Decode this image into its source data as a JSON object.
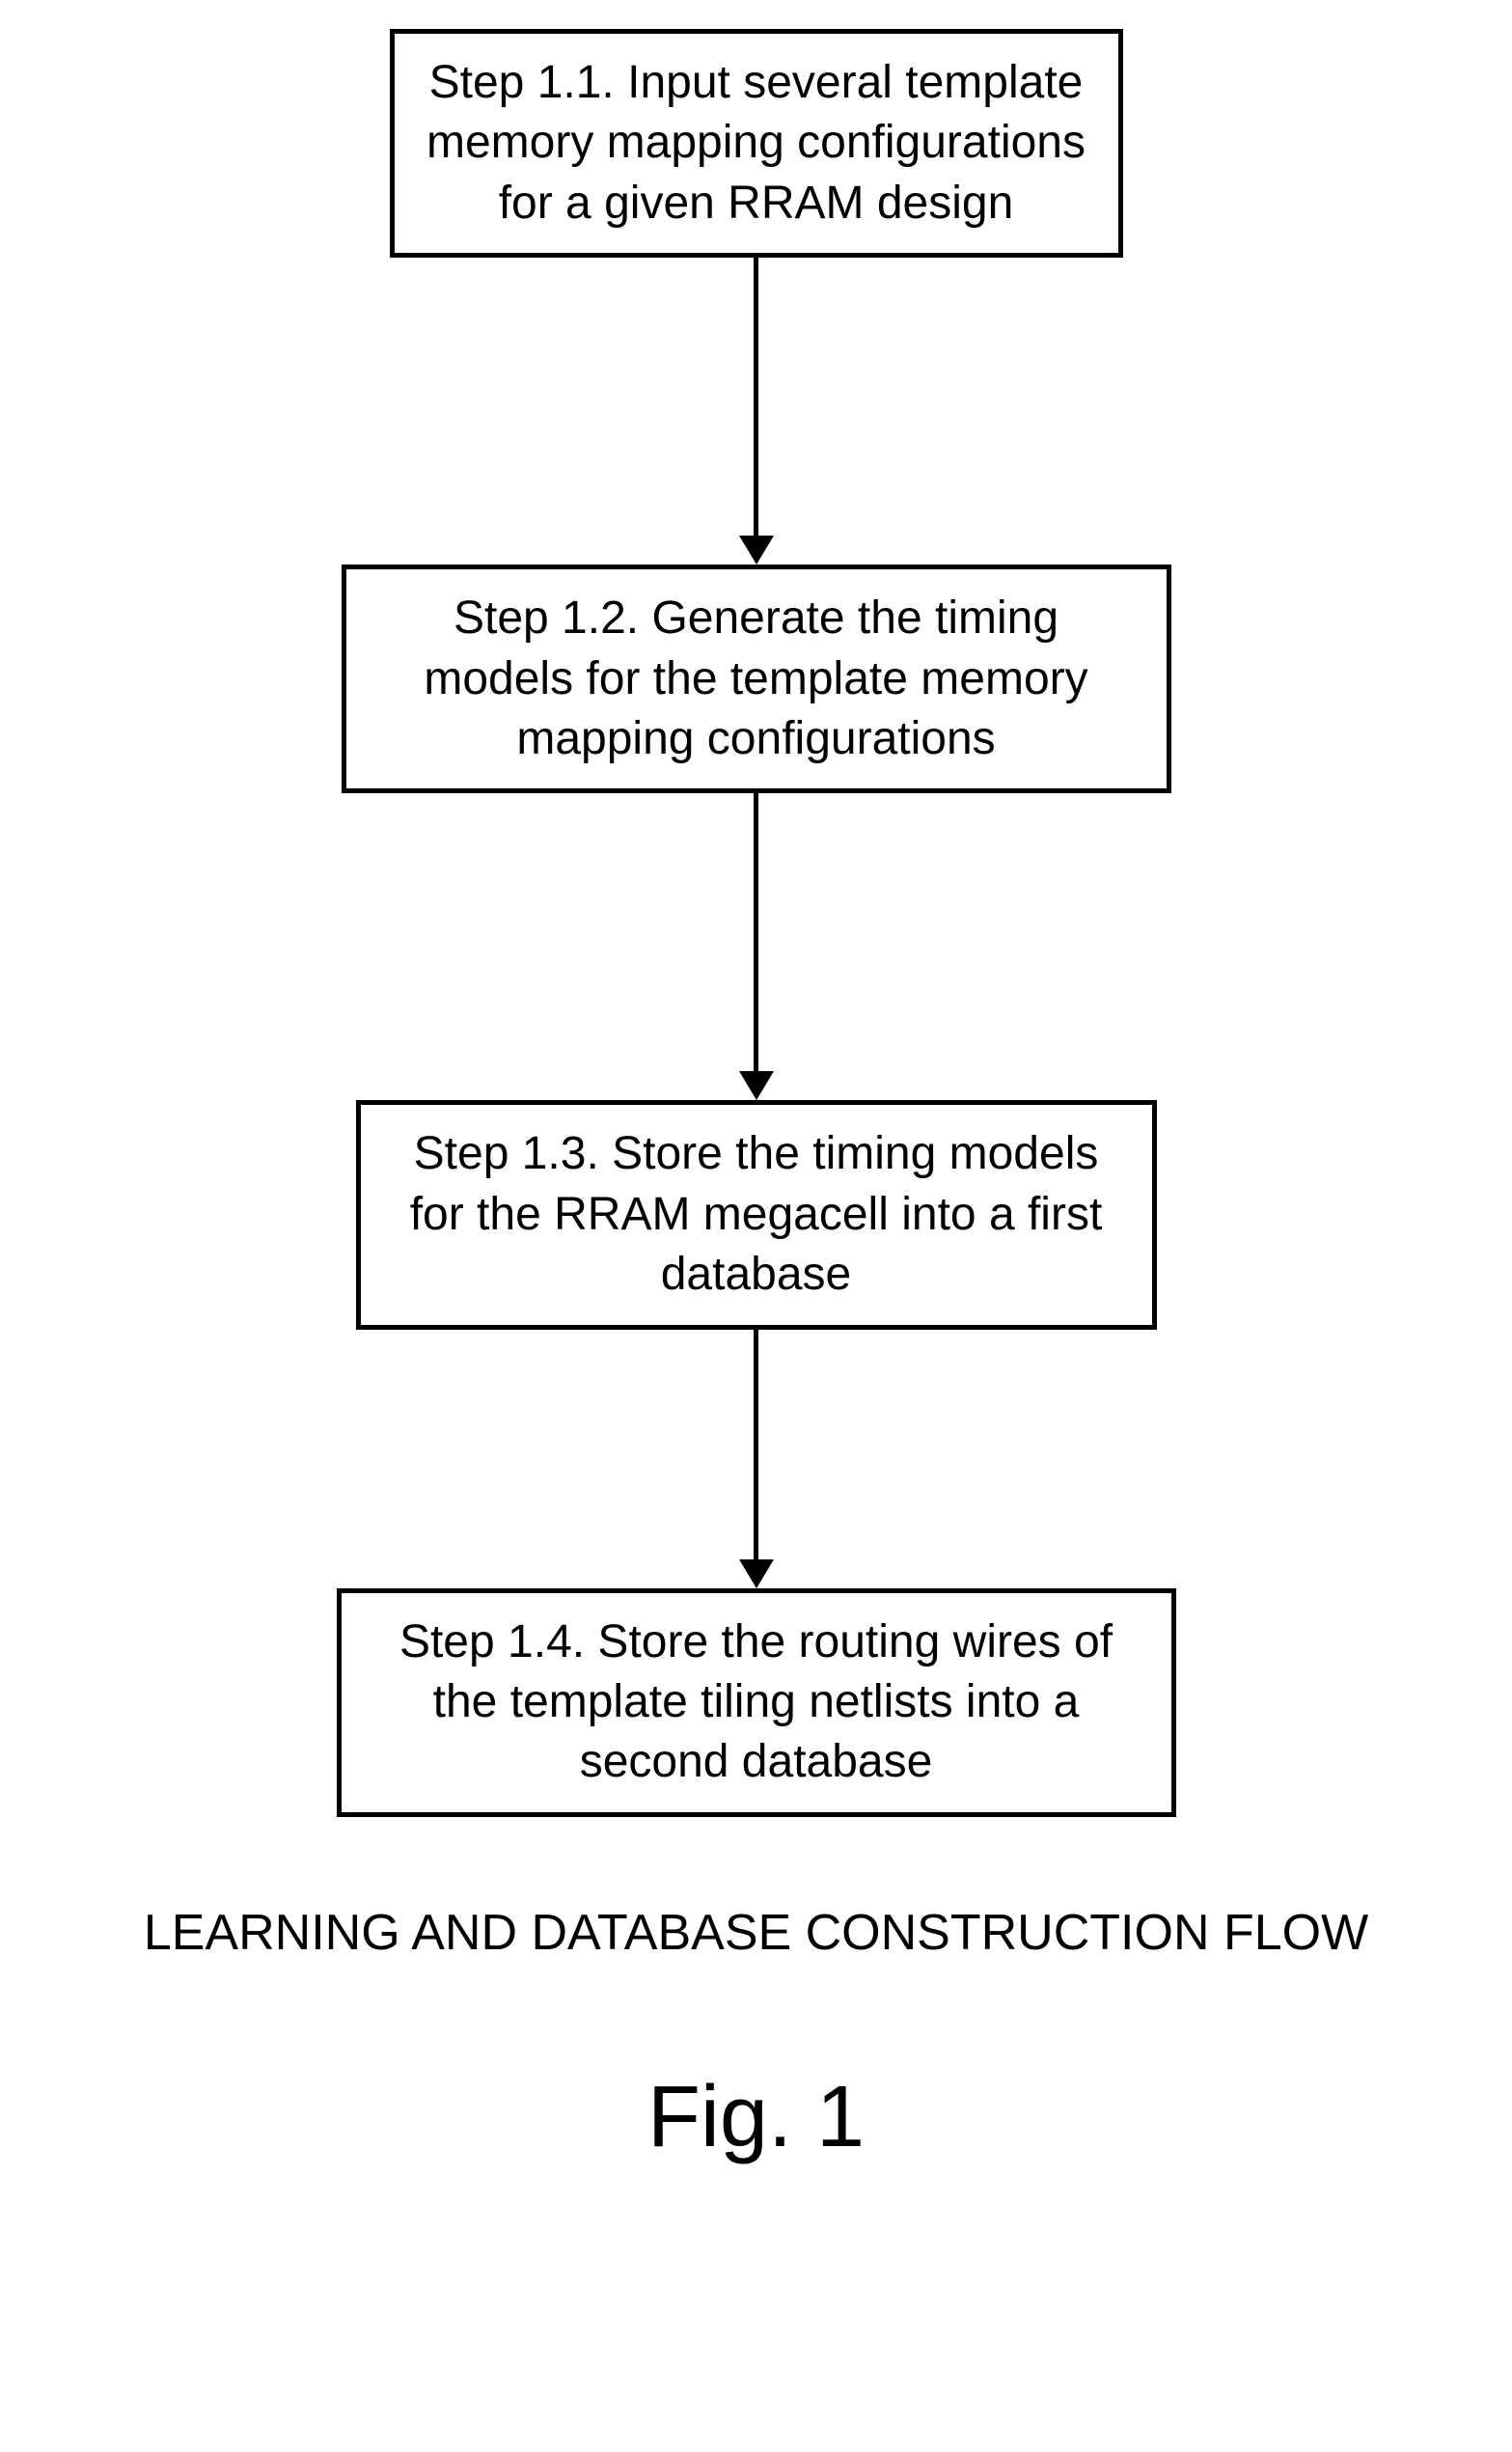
{
  "flowchart": {
    "steps": [
      "Step 1.1. Input several template memory mapping configurations for a given RRAM design",
      "Step 1.2. Generate the timing models for the template memory mapping configurations",
      "Step 1.3. Store the timing models for the RRAM megacell into a first database",
      "Step 1.4. Store the routing wires of the template tiling netlists into a second database"
    ],
    "caption": "LEARNING AND DATABASE CONSTRUCTION FLOW",
    "figure_label": "Fig. 1"
  }
}
